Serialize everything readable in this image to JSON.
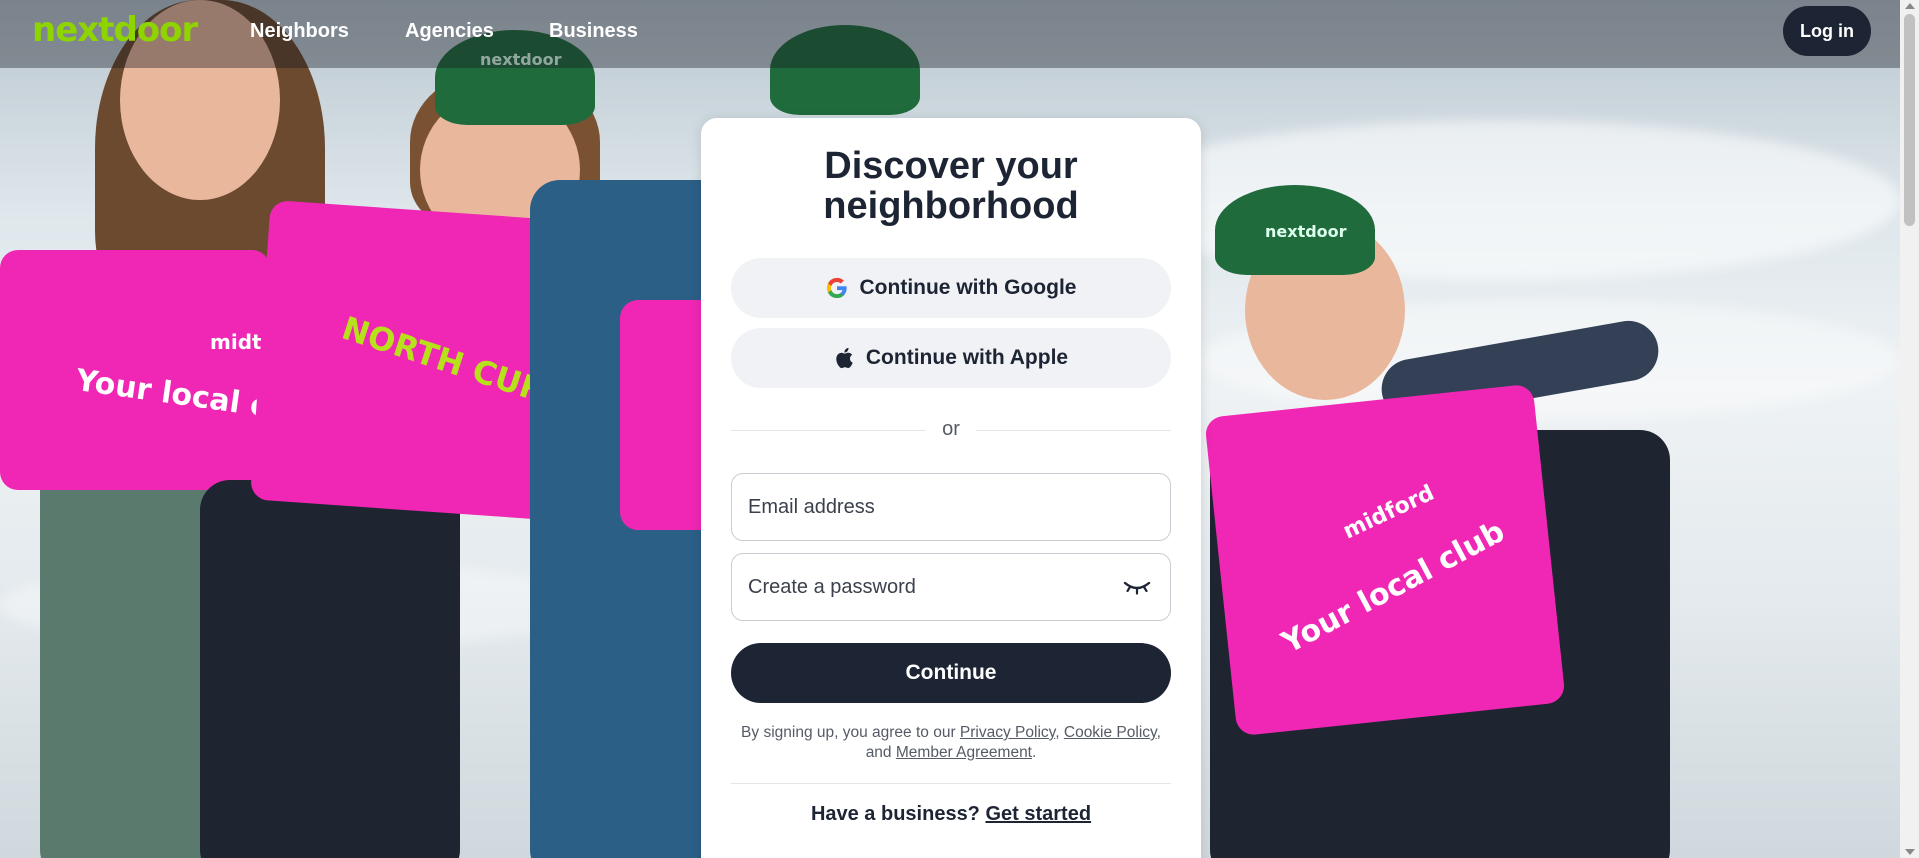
{
  "nav": {
    "logo": "nextdoor",
    "links": [
      "Neighbors",
      "Agencies",
      "Business"
    ],
    "login_label": "Log in"
  },
  "background": {
    "vest_texts": [
      "Your local club",
      "NORTH CURL CURL",
      "Your local club",
      "midford",
      "midt"
    ],
    "cap_text": "nextdoor"
  },
  "card": {
    "title_line1": "Discover your",
    "title_line2": "neighborhood",
    "google_label": "Continue with Google",
    "apple_label": "Continue with Apple",
    "divider": "or",
    "email_placeholder": "Email address",
    "password_placeholder": "Create a password",
    "continue_label": "Continue",
    "terms_prefix": "By signing up, you agree to our",
    "privacy_policy": "Privacy Policy",
    "comma": ",",
    "cookie_policy": "Cookie Policy",
    "and": ", and",
    "member_agreement": "Member Agreement",
    "period": ".",
    "business_prompt": "Have a business?",
    "get_started": "Get started"
  },
  "colors": {
    "brand_green": "#8ed500",
    "dark_navy": "#1d2433",
    "vest_pink": "#f027b4",
    "cap_green": "#1f6b3c"
  },
  "icons": [
    "google-icon",
    "apple-icon",
    "eye-closed-icon"
  ]
}
